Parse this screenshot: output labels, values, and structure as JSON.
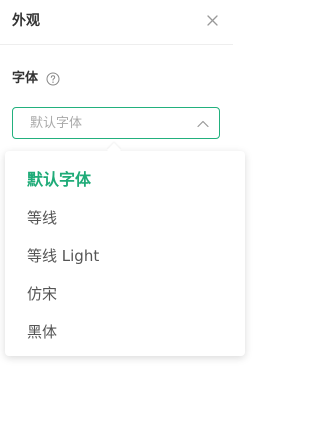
{
  "panel": {
    "title": "外观",
    "close_icon": "close-icon"
  },
  "font_section": {
    "label": "字体",
    "help_icon": "help-circle-icon"
  },
  "font_select": {
    "value": "默认字体",
    "chevron_icon": "chevron-up-icon"
  },
  "font_options": [
    {
      "label": "默认字体",
      "selected": true
    },
    {
      "label": "等线",
      "selected": false
    },
    {
      "label": "等线 Light",
      "selected": false
    },
    {
      "label": "仿宋",
      "selected": false
    },
    {
      "label": "黑体",
      "selected": false
    }
  ],
  "colors": {
    "accent": "#1fab78",
    "border_accent": "#22b07d",
    "text": "#333333",
    "muted": "#a9a9a9"
  }
}
